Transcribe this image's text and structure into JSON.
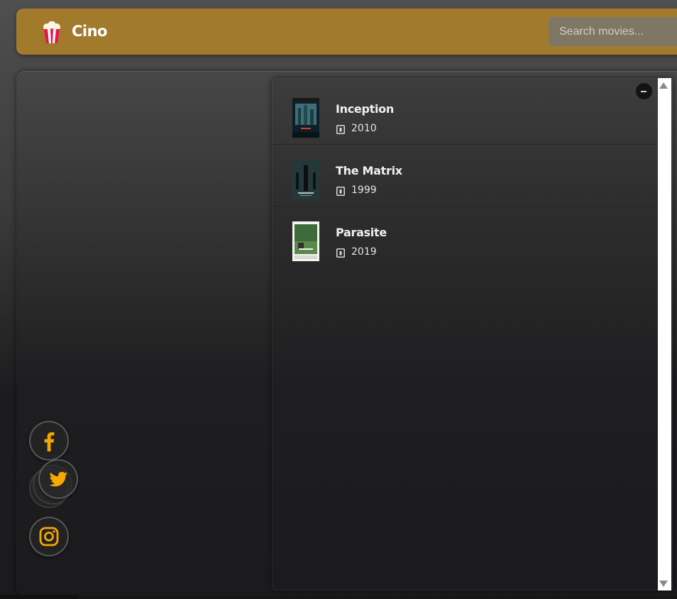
{
  "header": {
    "brand": "Cino",
    "logo_icon": "popcorn-icon",
    "search_placeholder": "Search movies..."
  },
  "results": [
    {
      "title": "Inception",
      "year": "2010"
    },
    {
      "title": "The Matrix",
      "year": "1999"
    },
    {
      "title": "Parasite",
      "year": "2019"
    }
  ],
  "social": [
    {
      "name": "facebook",
      "icon": "facebook-icon"
    },
    {
      "name": "twitter",
      "icon": "twitter-icon"
    },
    {
      "name": "instagram",
      "icon": "instagram-icon"
    }
  ],
  "colors": {
    "header": "#a27a2c",
    "accent": "#f5a800",
    "panel": "#1b1b1d"
  }
}
